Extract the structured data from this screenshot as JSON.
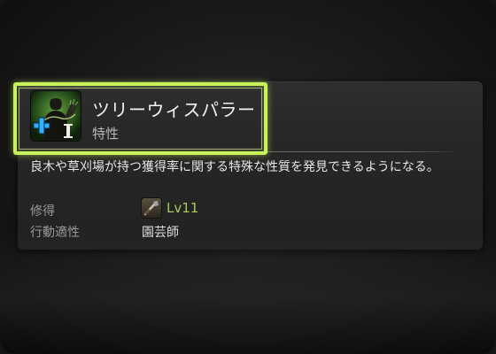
{
  "trait": {
    "name": "ツリーウィスパラー",
    "category": "特性",
    "icon": "botanist-trait-icon",
    "description": "良木や草刈場が持つ獲得率に関する特殊な性質を発見できるようになる。",
    "acquired_label": "修得",
    "acquired_level": "Lv11",
    "acquired_icon": "hatchet-icon",
    "job_label": "行動適性",
    "job_value": "園芸師"
  },
  "colors": {
    "highlight": "#c8f25a",
    "level_text": "#a6c95a",
    "panel": "#262626"
  }
}
